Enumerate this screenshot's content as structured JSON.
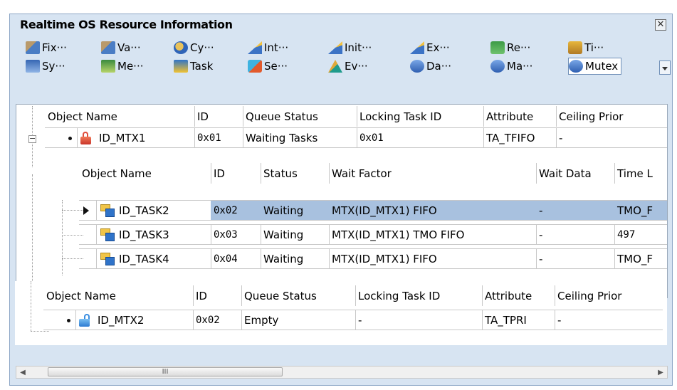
{
  "window": {
    "title": "Realtime OS Resource Information",
    "close_glyph": "✕"
  },
  "toolbar": {
    "row1": [
      {
        "label": "Fix···",
        "icon": "fixed-memory-pool-icon"
      },
      {
        "label": "Va···",
        "icon": "variable-memory-pool-icon"
      },
      {
        "label": "Cy···",
        "icon": "cyclic-handler-icon"
      },
      {
        "label": "Int···",
        "icon": "interrupt-handler-icon"
      },
      {
        "label": "Init···",
        "icon": "init-routine-icon"
      },
      {
        "label": "Ex···",
        "icon": "exception-icon"
      },
      {
        "label": "Re···",
        "icon": "ready-queue-icon"
      },
      {
        "label": "Ti···",
        "icon": "timer-icon"
      }
    ],
    "row2": [
      {
        "label": "Sy···",
        "icon": "system-icon"
      },
      {
        "label": "Me···",
        "icon": "memory-icon"
      },
      {
        "label": "Task",
        "icon": "task-icon"
      },
      {
        "label": "Se···",
        "icon": "semaphore-icon"
      },
      {
        "label": "Ev···",
        "icon": "eventflag-icon"
      },
      {
        "label": "Da···",
        "icon": "dataqueue-icon"
      },
      {
        "label": "Ma···",
        "icon": "mailbox-icon"
      },
      {
        "label": "Mutex",
        "icon": "mutex-icon",
        "active": true
      }
    ]
  },
  "mutex_headers": {
    "object_name": "Object Name",
    "id": "ID",
    "queue_status": "Queue Status",
    "locking_task_id": "Locking Task ID",
    "attribute": "Attribute",
    "ceiling": "Ceiling Prior"
  },
  "mutexes": [
    {
      "name": "ID_MTX1",
      "id": "0x01",
      "queue_status": "Waiting Tasks",
      "locking_task_id": "0x01",
      "attribute": "TA_TFIFO",
      "ceiling": "-"
    },
    {
      "name": "ID_MTX2",
      "id": "0x02",
      "queue_status": "Empty",
      "locking_task_id": "-",
      "attribute": "TA_TPRI",
      "ceiling": "-"
    }
  ],
  "task_headers": {
    "object_name": "Object Name",
    "id": "ID",
    "status": "Status",
    "wait_factor": "Wait Factor",
    "wait_data": "Wait Data",
    "time": "Time L"
  },
  "waiting_tasks": [
    {
      "name": "ID_TASK2",
      "id": "0x02",
      "status": "Waiting",
      "wait_factor": "MTX(ID_MTX1) FIFO",
      "wait_data": "-",
      "time": "TMO_F",
      "selected": true
    },
    {
      "name": "ID_TASK3",
      "id": "0x03",
      "status": "Waiting",
      "wait_factor": "MTX(ID_MTX1) TMO FIFO",
      "wait_data": "-",
      "time": "497"
    },
    {
      "name": "ID_TASK4",
      "id": "0x04",
      "status": "Waiting",
      "wait_factor": "MTX(ID_MTX1) FIFO",
      "wait_data": "-",
      "time": "TMO_F"
    }
  ],
  "scrollbar": {
    "grip": "III",
    "left_arrow": "◀",
    "right_arrow": "▶"
  },
  "colors": {
    "selection": "#a8c1df",
    "window_bg": "#d7e4f2",
    "locked_icon": "#e04b3a",
    "unlocked_icon": "#3a8de0"
  }
}
